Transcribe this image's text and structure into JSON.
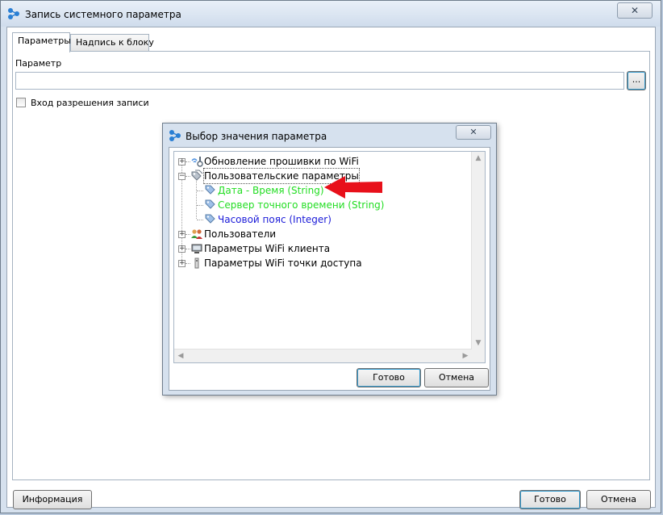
{
  "window": {
    "title": "Запись системного параметра",
    "close_glyph": "✕"
  },
  "tabs": [
    {
      "label": "Параметры"
    },
    {
      "label": "Надпись к блоку"
    }
  ],
  "form": {
    "param_label": "Параметр",
    "param_value": "",
    "browse_label": "...",
    "write_permission_label": "Вход разрешения записи"
  },
  "footer": {
    "info_label": "Информация",
    "ok_label": "Готово",
    "cancel_label": "Отмена"
  },
  "dialog": {
    "title": "Выбор значения параметра",
    "close_glyph": "✕",
    "tree": {
      "firmware": "Обновление прошивки по WiFi",
      "user_params": "Пользовательские параметры",
      "date_time": "Дата - Время (String)",
      "time_server": "Сервер точного времени (String)",
      "timezone": "Часовой пояс (Integer)",
      "users": "Пользователи",
      "wifi_client": "Параметры WiFi клиента",
      "wifi_ap": "Параметры WiFi точки доступа"
    },
    "ok_label": "Готово",
    "cancel_label": "Отмена"
  },
  "colors": {
    "selected_item": "#22dd22",
    "typed_item": "#1a1ad8",
    "arrow": "#e8101a"
  }
}
